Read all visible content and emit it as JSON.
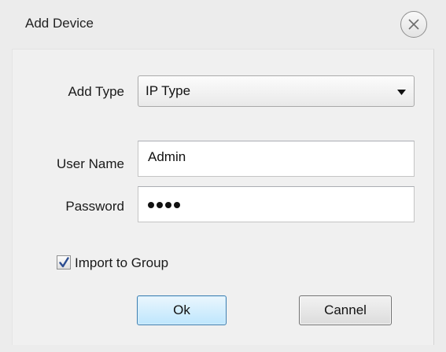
{
  "dialog": {
    "title": "Add Device",
    "close_icon": "close-x-icon"
  },
  "form": {
    "add_type": {
      "label": "Add Type",
      "value": "IP Type"
    },
    "username": {
      "label": "User Name",
      "value": "Admin"
    },
    "password": {
      "label": "Password",
      "masked_length": 4
    },
    "import_group": {
      "label": "Import to Group",
      "checked": true
    }
  },
  "buttons": {
    "ok_label": "Ok",
    "cancel_label": "Cannel"
  },
  "colors": {
    "window_bg": "#ececec",
    "panel_bg": "#f0f0f0",
    "ok_border": "#3c7fb1",
    "ok_fill": "#bee6fd"
  }
}
